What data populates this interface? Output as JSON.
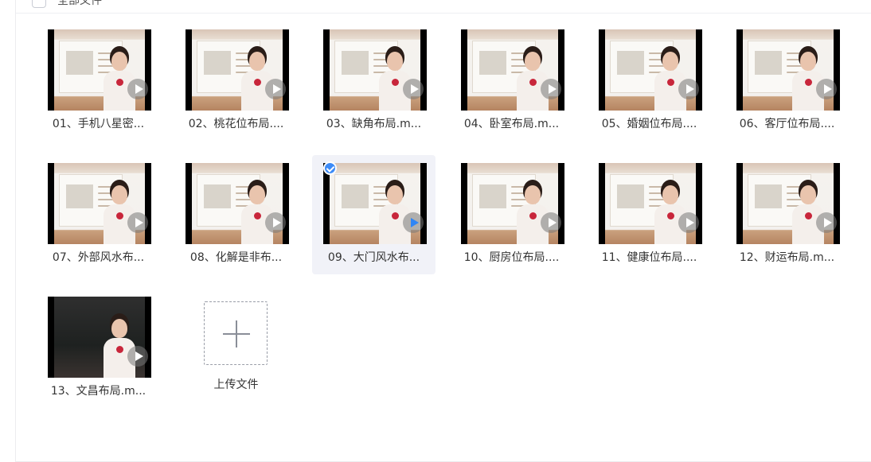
{
  "header": {
    "select_all_label": "全部文件"
  },
  "files": [
    {
      "name": "01、手机八星密...",
      "selected": false
    },
    {
      "name": "02、桃花位布局....",
      "selected": false
    },
    {
      "name": "03、缺角布局.m...",
      "selected": false
    },
    {
      "name": "04、卧室布局.m...",
      "selected": false
    },
    {
      "name": "05、婚姻位布局....",
      "selected": false
    },
    {
      "name": "06、客厅位布局....",
      "selected": false
    },
    {
      "name": "07、外部风水布...",
      "selected": false
    },
    {
      "name": "08、化解是非布...",
      "selected": false
    },
    {
      "name": "09、大门风水布...",
      "selected": true
    },
    {
      "name": "10、厨房位布局....",
      "selected": false
    },
    {
      "name": "11、健康位布局....",
      "selected": false
    },
    {
      "name": "12、财运布局.m...",
      "selected": false
    },
    {
      "name": "13、文昌布局.m...",
      "selected": false
    }
  ],
  "upload": {
    "label": "上传文件"
  },
  "colors": {
    "accent": "#3d8bf7",
    "selected_bg": "#f1f2f8"
  }
}
